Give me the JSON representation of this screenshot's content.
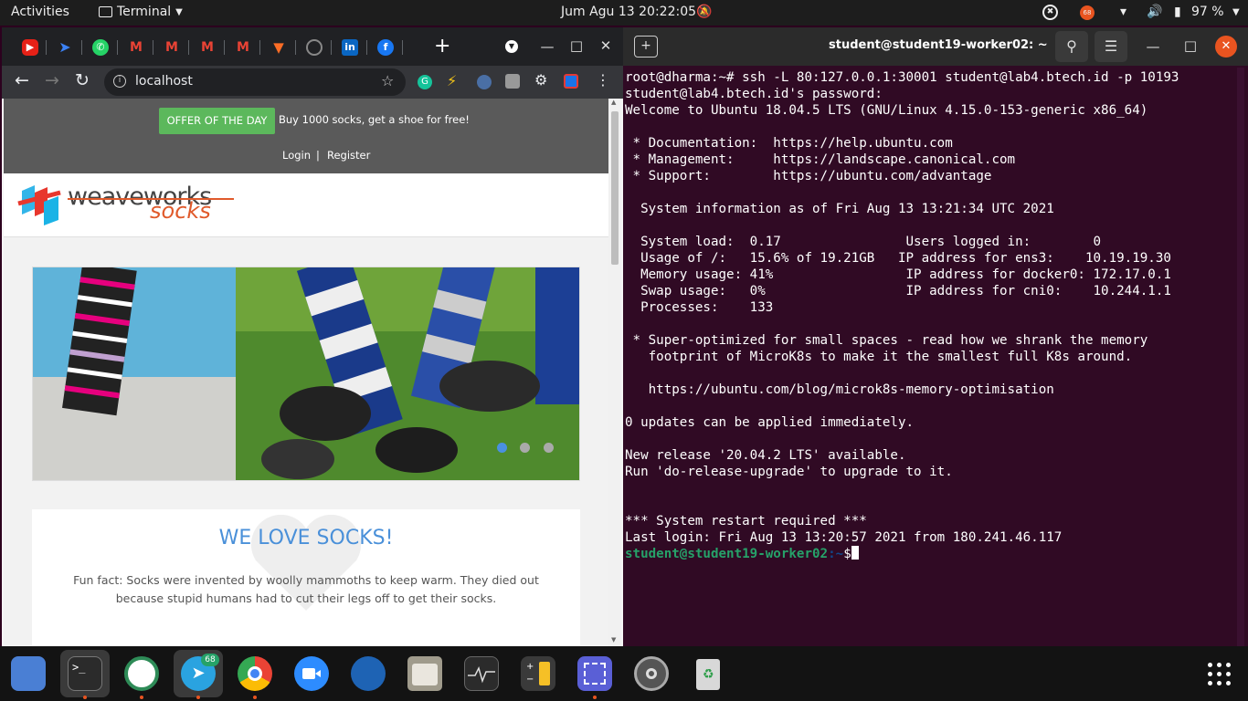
{
  "topbar": {
    "activities": "Activities",
    "app": "Terminal",
    "clock": "Jum Agu 13  20:22:05",
    "battery": "97 %",
    "notif_count": "68"
  },
  "browser": {
    "url": "localhost",
    "offer_label": "OFFER OF THE DAY",
    "offer_text": "Buy 1000 socks, get a shoe for free!",
    "login": "Login",
    "sep": "|",
    "register": "Register",
    "logo_top": "weaveworks",
    "logo_bottom": "socks",
    "love_title": "WE LOVE SOCKS!",
    "fun_fact": "Fun fact: Socks were invented by woolly mammoths to keep warm. They died out because stupid humans had to cut their legs off to get their socks."
  },
  "terminal": {
    "title": "student@student19-worker02: ~",
    "lines": [
      "root@dharma:~# ssh -L 80:127.0.0.1:30001 student@lab4.btech.id -p 10193",
      "student@lab4.btech.id's password:",
      "Welcome to Ubuntu 18.04.5 LTS (GNU/Linux 4.15.0-153-generic x86_64)",
      "",
      " * Documentation:  https://help.ubuntu.com",
      " * Management:     https://landscape.canonical.com",
      " * Support:        https://ubuntu.com/advantage",
      "",
      "  System information as of Fri Aug 13 13:21:34 UTC 2021",
      "",
      "  System load:  0.17                Users logged in:        0",
      "  Usage of /:   15.6% of 19.21GB   IP address for ens3:    10.19.19.30",
      "  Memory usage: 41%                 IP address for docker0: 172.17.0.1",
      "  Swap usage:   0%                  IP address for cni0:    10.244.1.1",
      "  Processes:    133",
      "",
      " * Super-optimized for small spaces - read how we shrank the memory",
      "   footprint of MicroK8s to make it the smallest full K8s around.",
      "",
      "   https://ubuntu.com/blog/microk8s-memory-optimisation",
      "",
      "0 updates can be applied immediately.",
      "",
      "New release '20.04.2 LTS' available.",
      "Run 'do-release-upgrade' to upgrade to it.",
      "",
      "",
      "*** System restart required ***",
      "Last login: Fri Aug 13 13:20:57 2021 from 180.241.46.117"
    ],
    "prompt_user": "student@student19-worker02",
    "prompt_path": ":~",
    "prompt_sym": "$"
  },
  "dock": {
    "telegram_badge": "68"
  }
}
